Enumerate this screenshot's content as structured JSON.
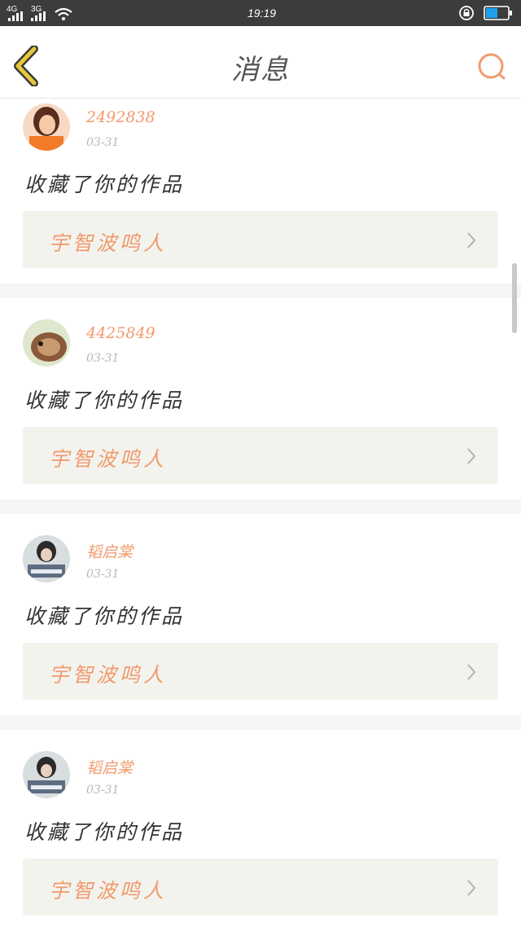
{
  "status_bar": {
    "net1": "4G",
    "net2": "3G",
    "time": "19:19",
    "icons": [
      "signal-icon",
      "signal-icon",
      "wifi-icon",
      "rotation-lock-icon",
      "battery-icon"
    ],
    "battery_level": 0.55
  },
  "header": {
    "title": "消息",
    "back_icon": "chevron-left-icon",
    "search_icon": "search-icon",
    "accent_color": "#f29a6e",
    "back_color": "#e8c83a"
  },
  "messages": [
    {
      "user": "2492838",
      "date": "03-31",
      "action": "收藏了你的作品",
      "work": "宇智波鸣人",
      "avatar_color": "#f27b2a"
    },
    {
      "user": "4425849",
      "date": "03-31",
      "action": "收藏了你的作品",
      "work": "宇智波鸣人",
      "avatar_color": "#8a5a3a"
    },
    {
      "user": "韬启棠",
      "date": "03-31",
      "action": "收藏了你的作品",
      "work": "宇智波鸣人",
      "avatar_color": "#3a4a5a"
    },
    {
      "user": "韬启棠",
      "date": "03-31",
      "action": "收藏了你的作品",
      "work": "宇智波鸣人",
      "avatar_color": "#3a4a5a"
    }
  ]
}
